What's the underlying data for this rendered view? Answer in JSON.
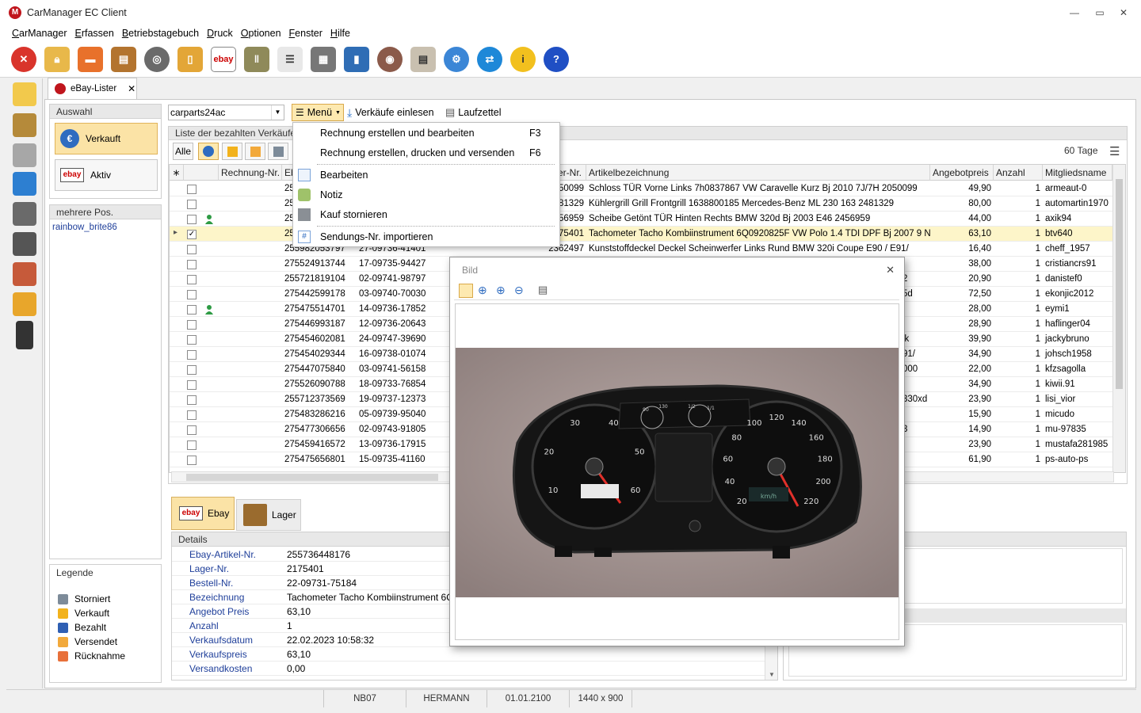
{
  "app": {
    "title": "CarManager EC Client"
  },
  "menubar": [
    "CarManager",
    "Erfassen",
    "Betriebstagebuch",
    "Druck",
    "Optionen",
    "Fenster",
    "Hilfe"
  ],
  "toolbar_icons": [
    "stop-icon",
    "lock-icon",
    "car-icon",
    "shelf-icon",
    "steering-wheel-icon",
    "key-tag-icon",
    "ebay-icon",
    "binders-icon",
    "checklist-icon",
    "calculator-icon",
    "book-icon",
    "brake-disc-icon",
    "printer-icon",
    "gear-icon",
    "transfer-icon",
    "info-icon",
    "help-icon"
  ],
  "doc_tab": {
    "label": "eBay-Lister",
    "close": "✕"
  },
  "account_select": {
    "value": "carparts24ac"
  },
  "actions": {
    "menu": "Menü",
    "import": "Verkäufe einlesen",
    "laufzettel": "Laufzettel"
  },
  "auswahl": {
    "title": "Auswahl",
    "verkauft": "Verkauft",
    "aktiv": "Aktiv"
  },
  "mehrere": {
    "title": "mehrere Pos.",
    "item": "rainbow_brite86"
  },
  "legende": {
    "title": "Legende",
    "items": [
      {
        "label": "Storniert",
        "color": "#7d8b99"
      },
      {
        "label": "Verkauft",
        "color": "#f2b21c"
      },
      {
        "label": "Bezahlt",
        "color": "#2f5fb3"
      },
      {
        "label": "Versendet",
        "color": "#f2a93b"
      },
      {
        "label": "Rücknahme",
        "color": "#e8703a"
      }
    ]
  },
  "list": {
    "title": "Liste der bezahlten Verkäufe",
    "filter_all": "Alle",
    "days": "60 Tage"
  },
  "grid": {
    "headers": [
      "Rechnung-Nr.",
      "Eb",
      "er-Nr.",
      "Artikelbezeichnung",
      "Angebotpreis",
      "Anzahl",
      "Mitgliedsname"
    ],
    "rows": [
      {
        "c1": "25",
        "c2": "",
        "c3": "50099",
        "desc": "Schloss TÜR Vorne Links 7h0837867 VW Caravelle Kurz Bj 2010 7J/7H 2050099",
        "price": "49,90",
        "qty": "1",
        "member": "armeaut-0",
        "checked": false,
        "person": false
      },
      {
        "c1": "25",
        "c2": "",
        "c3": "81329",
        "desc": "Kühlergrill Grill Frontgrill 1638800185 Mercedes-Benz ML 230 163 2481329",
        "price": "80,00",
        "qty": "1",
        "member": "automartin1970",
        "checked": false,
        "person": false
      },
      {
        "c1": "25",
        "c2": "",
        "c3": "56959",
        "desc": "Scheibe Getönt TÜR Hinten Rechts BMW 320d Bj 2003 E46 2456959",
        "price": "44,00",
        "qty": "1",
        "member": "axik94",
        "checked": false,
        "person": true
      },
      {
        "c1": "25",
        "c2": "",
        "c3": "75401",
        "desc": "Tachometer Tacho Kombiinstrument 6Q0920825F VW Polo 1.4 TDI DPF Bj 2007 9 N",
        "price": "63,10",
        "qty": "1",
        "member": "btv640",
        "checked": true,
        "person": false
      },
      {
        "c1": "255982053797",
        "c2": "27-09736-41401",
        "c3": "2362497",
        "desc": "Kunststoffdeckel Deckel Scheinwerfer Links Rund BMW 320i Coupe E90 / E91/",
        "price": "16,40",
        "qty": "1",
        "member": "cheff_1957",
        "checked": false,
        "person": false
      },
      {
        "c1": "275524913744",
        "c2": "17-09735-94427",
        "c3": "",
        "desc": "",
        "price": "38,00",
        "qty": "1",
        "member": "cristiancrs91",
        "checked": false,
        "person": false
      },
      {
        "c1": "255721819104",
        "c2": "02-09741-98797",
        "c3": "",
        "desc": "",
        "price": "20,90",
        "qty": "1",
        "member": "danistef0",
        "checked": false,
        "person": false
      },
      {
        "c1": "275442599178",
        "c2": "03-09740-70030",
        "c3": "",
        "desc": "",
        "price": "72,50",
        "qty": "1",
        "member": "ekonjic2012",
        "checked": false,
        "person": false
      },
      {
        "c1": "275475514701",
        "c2": "14-09736-17852",
        "c3": "",
        "desc": "",
        "price": "28,00",
        "qty": "1",
        "member": "eymi1",
        "checked": false,
        "person": true
      },
      {
        "c1": "275446993187",
        "c2": "12-09736-20643",
        "c3": "",
        "desc": "",
        "price": "28,90",
        "qty": "1",
        "member": "haflinger04",
        "checked": false,
        "person": false
      },
      {
        "c1": "275454602081",
        "c2": "24-09747-39690",
        "c3": "",
        "desc": "",
        "price": "39,90",
        "qty": "1",
        "member": "jackybruno",
        "checked": false,
        "person": false
      },
      {
        "c1": "275454029344",
        "c2": "16-09738-01074",
        "c3": "",
        "desc": "",
        "price": "34,90",
        "qty": "1",
        "member": "johsch1958",
        "checked": false,
        "person": false
      },
      {
        "c1": "275447075840",
        "c2": "03-09741-56158",
        "c3": "",
        "desc": "",
        "price": "22,00",
        "qty": "1",
        "member": "kfzsagolla",
        "checked": false,
        "person": false
      },
      {
        "c1": "275526090788",
        "c2": "18-09733-76854",
        "c3": "",
        "desc": "",
        "price": "34,90",
        "qty": "1",
        "member": "kiwii.91",
        "checked": false,
        "person": false
      },
      {
        "c1": "255712373569",
        "c2": "19-09737-12373",
        "c3": "",
        "desc": "",
        "price": "23,90",
        "qty": "1",
        "member": "lisi_vior",
        "checked": false,
        "person": false
      },
      {
        "c1": "275483286216",
        "c2": "05-09739-95040",
        "c3": "",
        "desc": "",
        "price": "15,90",
        "qty": "1",
        "member": "micudo",
        "checked": false,
        "person": false
      },
      {
        "c1": "275477306656",
        "c2": "02-09743-91805",
        "c3": "",
        "desc": "",
        "price": "14,90",
        "qty": "1",
        "member": "mu-97835",
        "checked": false,
        "person": false
      },
      {
        "c1": "275459416572",
        "c2": "13-09736-17915",
        "c3": "",
        "desc": "",
        "price": "23,90",
        "qty": "1",
        "member": "mustafa281985",
        "checked": false,
        "person": false
      },
      {
        "c1": "275475656801",
        "c2": "15-09735-41160",
        "c3": "",
        "desc": "",
        "price": "61,90",
        "qty": "1",
        "member": "ps-auto-ps",
        "checked": false,
        "person": false
      }
    ],
    "clipped_fragments": [
      {
        "text": "2",
        "row": 6
      },
      {
        "text": "5d",
        "row": 7
      },
      {
        "text": "ik",
        "row": 10
      },
      {
        "text": "91/",
        "row": 11
      },
      {
        "text": "000",
        "row": 12
      },
      {
        "text": "330xd",
        "row": 14
      },
      {
        "text": "3",
        "row": 16
      }
    ]
  },
  "popup_menu": {
    "items": [
      {
        "label": "Rechnung erstellen und bearbeiten",
        "shortcut": "F3"
      },
      {
        "label": "Rechnung erstellen, drucken und versenden",
        "shortcut": "F6"
      },
      {
        "label": "Bearbeiten",
        "shortcut": ""
      },
      {
        "label": "Notiz",
        "shortcut": ""
      },
      {
        "label": "Kauf stornieren",
        "shortcut": ""
      },
      {
        "label": "Sendungs-Nr. importieren",
        "shortcut": ""
      }
    ]
  },
  "image_window": {
    "title": "Bild",
    "close": "✕"
  },
  "bottom_tabs": {
    "ebay": "Ebay",
    "lager": "Lager"
  },
  "details": {
    "title": "Details",
    "rows": [
      {
        "label": "Ebay-Artikel-Nr.",
        "value": "255736448176"
      },
      {
        "label": "Lager-Nr.",
        "value": "2175401"
      },
      {
        "label": "Bestell-Nr.",
        "value": "22-09731-75184"
      },
      {
        "label": "Bezeichnung",
        "value": "Tachometer Tacho Kombiinstrument 6Q092"
      },
      {
        "label": "Angebot Preis",
        "value": "63,10"
      },
      {
        "label": "Anzahl",
        "value": "1"
      },
      {
        "label": "Verkaufsdatum",
        "value": "22.02.2023 10:58:32"
      },
      {
        "label": "Verkaufspreis",
        "value": "63,10"
      },
      {
        "label": "Versandkosten",
        "value": "0,00"
      }
    ]
  },
  "statusbar": {
    "s1": "NB07",
    "s2": "HERMANN",
    "s3": "01.01.2100",
    "s4": "1440 x 900"
  },
  "gauges": {
    "left_ticks": [
      "10",
      "20",
      "30",
      "40",
      "50",
      "60"
    ],
    "right_ticks": [
      "20",
      "40",
      "60",
      "80",
      "100",
      "120",
      "140",
      "160",
      "180",
      "200",
      "220"
    ],
    "small_left": [
      "90",
      "130"
    ],
    "small_right": [
      "1/2",
      "1/1"
    ],
    "unit_right": "km/h"
  }
}
